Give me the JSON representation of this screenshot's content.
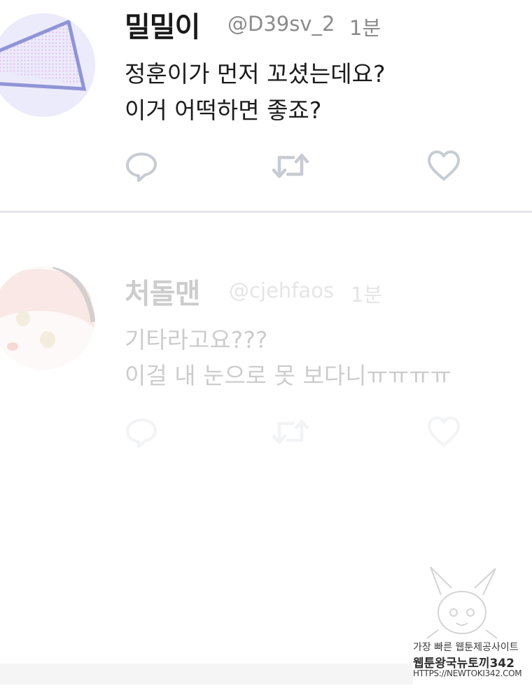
{
  "tweets": [
    {
      "name": "밀밀이",
      "handle": "@D39sv_2",
      "time": "1분",
      "lines": [
        "정훈이가 먼저 꼬셨는데요?",
        "이거 어떡하면 좋죠?"
      ],
      "actions": [
        "reply-icon",
        "retweet-icon",
        "like-icon"
      ]
    },
    {
      "name": "처돌맨",
      "handle": "@cjehfaos",
      "time": "1분",
      "lines": [
        "기타라고요???",
        "이걸 내 눈으로 못 보다니ㅠㅠㅠㅠ"
      ],
      "actions": [
        "reply-icon",
        "retweet-icon",
        "like-icon"
      ]
    }
  ],
  "watermark": {
    "line1": "가장 빠른 웹툰제공사이트",
    "line2": "웹툰왕국뉴토끼342",
    "line3": "HTTPS://NEWTOKI342.COM"
  },
  "colors": {
    "divider": "#e6e6ea",
    "icon": "#c7ccd3",
    "name": "#1a1a1a",
    "handle": "#8b8b8b"
  }
}
